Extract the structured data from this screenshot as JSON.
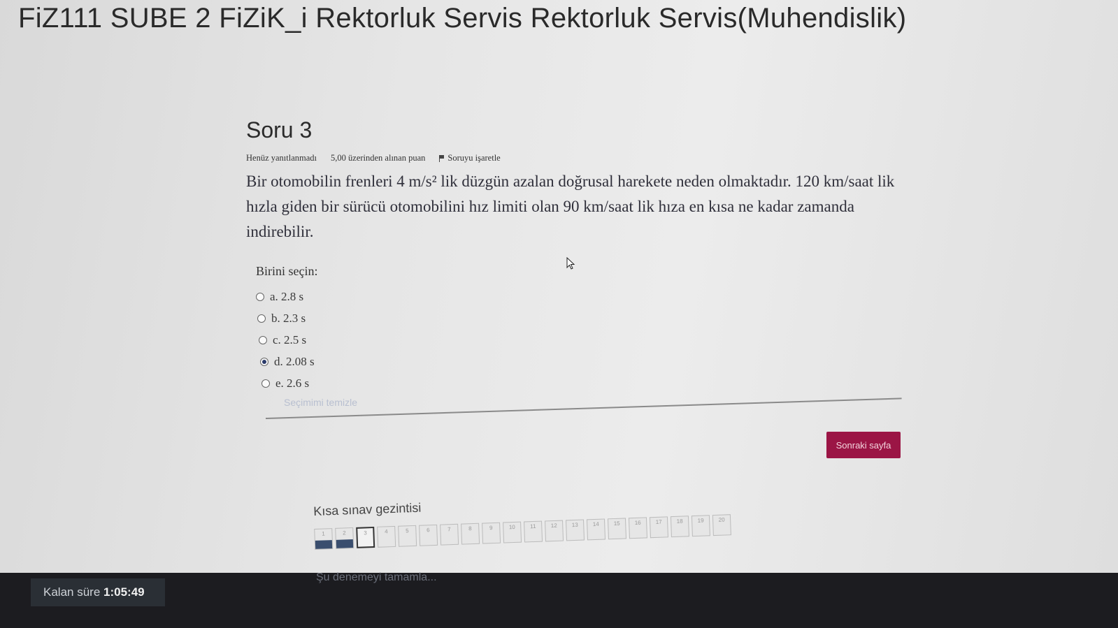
{
  "header": {
    "title": "FiZ111 SUBE 2 FiZiK_i Rektorluk Servis Rektorluk Servis(Muhendislik)"
  },
  "question": {
    "title": "Soru 3",
    "status": "Henüz yanıtlanmadı",
    "points": "5,00 üzerinden alınan puan",
    "flag_label": "Soruyu işaretle",
    "text": "Bir otomobilin frenleri 4 m/s² lik düzgün azalan doğrusal harekete neden olmaktadır. 120 km/saat lik hızla giden bir sürücü otomobilini hız limiti olan 90 km/saat lik hıza en kısa ne kadar zamanda indirebilir."
  },
  "answer": {
    "prompt": "Birini seçin:",
    "options": [
      {
        "label": "a. 2.8 s",
        "selected": false
      },
      {
        "label": "b. 2.3 s",
        "selected": false
      },
      {
        "label": "c. 2.5 s",
        "selected": false
      },
      {
        "label": "d. 2.08 s",
        "selected": true
      },
      {
        "label": "e. 2.6 s",
        "selected": false
      }
    ],
    "clear_label": "Seçimimi temizle"
  },
  "next_button": {
    "label": "Sonraki sayfa"
  },
  "navigation": {
    "title": "Kısa sınav gezintisi",
    "buttons": [
      {
        "label": "1",
        "state": "answered"
      },
      {
        "label": "2",
        "state": "answered"
      },
      {
        "label": "3",
        "state": "current"
      },
      {
        "label": "4",
        "state": "empty"
      },
      {
        "label": "5",
        "state": "empty"
      },
      {
        "label": "6",
        "state": "empty"
      },
      {
        "label": "7",
        "state": "empty"
      },
      {
        "label": "8",
        "state": "empty"
      },
      {
        "label": "9",
        "state": "empty"
      },
      {
        "label": "10",
        "state": "empty"
      },
      {
        "label": "11",
        "state": "empty"
      },
      {
        "label": "12",
        "state": "empty"
      },
      {
        "label": "13",
        "state": "empty"
      },
      {
        "label": "14",
        "state": "empty"
      },
      {
        "label": "15",
        "state": "empty"
      },
      {
        "label": "16",
        "state": "empty"
      },
      {
        "label": "17",
        "state": "empty"
      },
      {
        "label": "18",
        "state": "empty"
      },
      {
        "label": "19",
        "state": "empty"
      },
      {
        "label": "20",
        "state": "empty"
      }
    ],
    "finish_label": "Şu denemeyi tamamla..."
  },
  "timer": {
    "label": "Kalan süre",
    "value": "1:05:49"
  },
  "colors": {
    "accent": "#9b1545",
    "answered": "#3a4e6e"
  }
}
